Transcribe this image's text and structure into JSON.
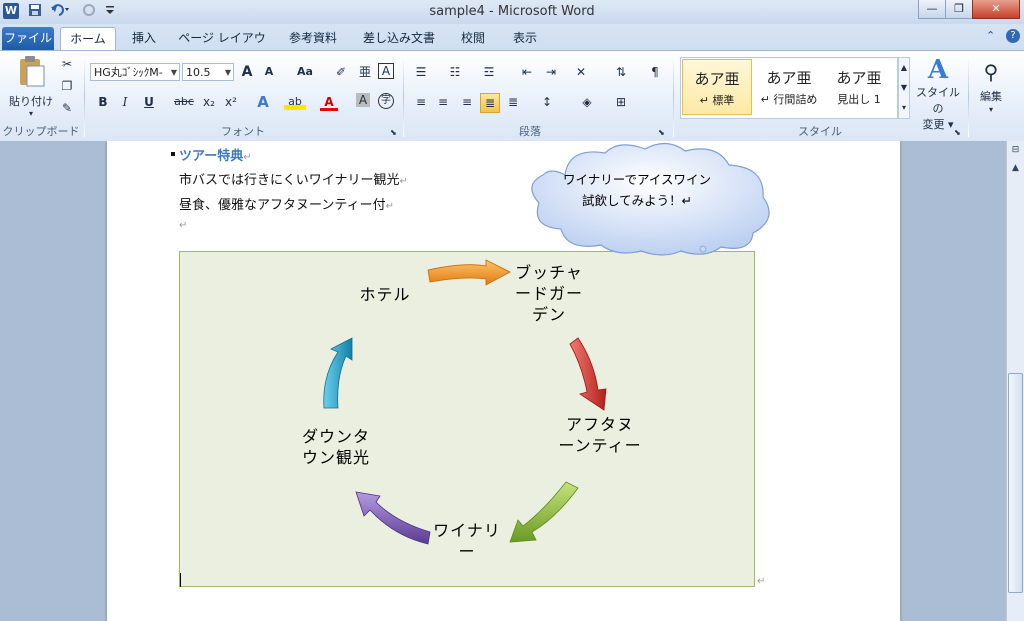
{
  "window": {
    "title": "sample4 - Microsoft Word",
    "logo": "W",
    "quick_access": [
      "save-icon",
      "undo-icon",
      "redo-icon",
      "customize-qat-icon"
    ]
  },
  "tabs": [
    {
      "label": "ファイル"
    },
    {
      "label": "ホーム"
    },
    {
      "label": "挿入"
    },
    {
      "label": "ページ レイアウト"
    },
    {
      "label": "参考資料"
    },
    {
      "label": "差し込み文書"
    },
    {
      "label": "校閲"
    },
    {
      "label": "表示"
    }
  ],
  "ribbon": {
    "clipboard": {
      "paste_label": "貼り付け",
      "group_label": "クリップボード"
    },
    "font": {
      "font_name": "HG丸ｺﾞｼｯｸM-",
      "font_size": "10.5",
      "group_label": "フォント",
      "btn_grow": "A",
      "btn_shrink": "A",
      "btn_case": "Aa",
      "btn_bold": "B",
      "btn_italic": "I",
      "btn_underline": "U",
      "btn_strike": "abc",
      "btn_sub": "x₂",
      "btn_sup": "x²",
      "btn_effect": "A",
      "btn_highlight": "ab",
      "btn_color": "A",
      "btn_shade": "A",
      "btn_enclose": "字"
    },
    "paragraph": {
      "group_label": "段落"
    },
    "styles": {
      "group_label": "スタイル",
      "items": [
        {
          "preview": "あア亜",
          "name": "↵ 標準"
        },
        {
          "preview": "あア亜",
          "name": "↵ 行間詰め"
        },
        {
          "preview": "あア亜",
          "name": "見出し 1"
        }
      ],
      "change_label_1": "スタイルの",
      "change_label_2": "変更 ▾"
    },
    "editing": {
      "label": "編集"
    }
  },
  "document": {
    "heading": "ツアー特典",
    "line1": "市バスでは行きにくいワイナリー観光",
    "line2": "昼食、優雅なアフタヌーンティー付",
    "para_mark": "↵",
    "callout": "ワイナリーでアイスワイン試飲してみよう！↵",
    "cycle": {
      "item1": "ホテル",
      "item2": "ブッチャードガーデン",
      "item3": "アフタヌーンティー",
      "item4": "ワイナリー",
      "item5": "ダウンタウン観光"
    },
    "arrow_colors": [
      "#f08a1c",
      "#d8302a",
      "#86b83a",
      "#7a56b0",
      "#1f9fc4"
    ]
  }
}
